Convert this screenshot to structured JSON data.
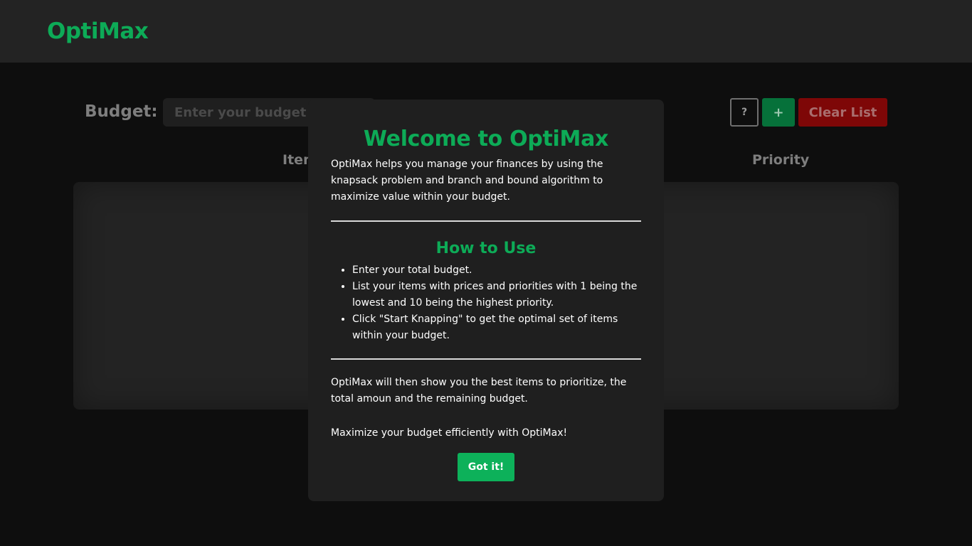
{
  "header": {
    "logo": "OptiMax"
  },
  "toolbar": {
    "budget_label": "Budget:",
    "budget_placeholder": "Enter your budget",
    "help_label": "?",
    "add_label": "+",
    "clear_label": "Clear List"
  },
  "table": {
    "columns": [
      "Item",
      "Priority"
    ]
  },
  "modal": {
    "title": "Welcome to OptiMax",
    "intro": "OptiMax helps you manage your finances by using the knapsack problem and branch and bound algorithm to maximize value within your budget.",
    "subtitle": "How to Use",
    "steps": [
      "Enter your total budget.",
      "List your items with prices and priorities with 1 being the lowest and 10 being the highest priority.",
      "Click \"Start Knapping\" to get the optimal set of items within your budget."
    ],
    "outro": "OptiMax will then show you the best items to prioritize, the total amoun and the remaining budget.",
    "closing": "Maximize your budget efficiently with OptiMax!",
    "confirm_label": "Got it!"
  },
  "colors": {
    "accent": "#0dab57",
    "danger": "#7e0707",
    "background": "#0e0e0e",
    "surface": "#1f1f1f"
  }
}
